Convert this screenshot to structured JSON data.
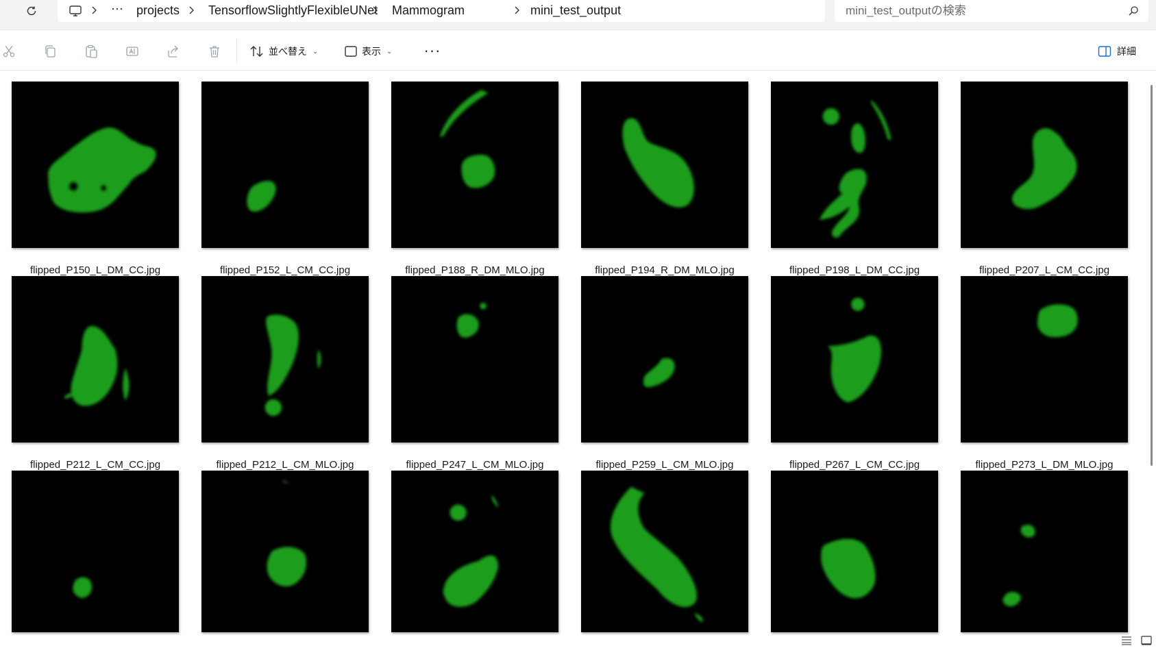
{
  "breadcrumb": {
    "items": [
      "projects",
      "TensorflowSlightlyFlexibleUNet",
      "Mammogram",
      "mini_test_output"
    ],
    "overflow": "···"
  },
  "search": {
    "placeholder": "mini_test_outputの検索"
  },
  "toolbar": {
    "sort_label": "並べ替え",
    "view_label": "表示",
    "more": "···",
    "details_label": "詳細"
  },
  "icons": {
    "refresh": "refresh-icon",
    "computer": "computer-icon",
    "chevron": "chevron-right-icon",
    "search": "search-icon",
    "cut": "cut-icon",
    "copy": "copy-icon",
    "paste": "paste-icon",
    "rename": "rename-icon",
    "share": "share-icon",
    "delete": "delete-icon",
    "sort": "sort-icon",
    "view": "view-icon",
    "details": "details-pane-icon",
    "list_view": "list-view-icon",
    "tiles_view": "large-icons-view-icon"
  },
  "colors": {
    "mask": "#1f9e1f",
    "thumbnail_bg": "#000000",
    "toolbar_bg": "#ffffff",
    "address_bg": "#f3f3f3"
  },
  "files": [
    {
      "name": "flipped_P150_L_DM_CC.jpg"
    },
    {
      "name": "flipped_P152_L_CM_CC.jpg"
    },
    {
      "name": "flipped_P188_R_DM_MLO.jpg"
    },
    {
      "name": "flipped_P194_R_DM_MLO.jpg"
    },
    {
      "name": "flipped_P198_L_DM_CC.jpg"
    },
    {
      "name": "flipped_P207_L_CM_CC.jpg"
    },
    {
      "name": "flipped_P212_L_CM_CC.jpg"
    },
    {
      "name": "flipped_P212_L_CM_MLO.jpg"
    },
    {
      "name": "flipped_P247_L_CM_MLO.jpg"
    },
    {
      "name": "flipped_P259_L_CM_MLO.jpg"
    },
    {
      "name": "flipped_P267_L_CM_CC.jpg"
    },
    {
      "name": "flipped_P273_L_DM_MLO.jpg"
    },
    {
      "name": ""
    },
    {
      "name": ""
    },
    {
      "name": ""
    },
    {
      "name": ""
    },
    {
      "name": ""
    },
    {
      "name": ""
    }
  ]
}
